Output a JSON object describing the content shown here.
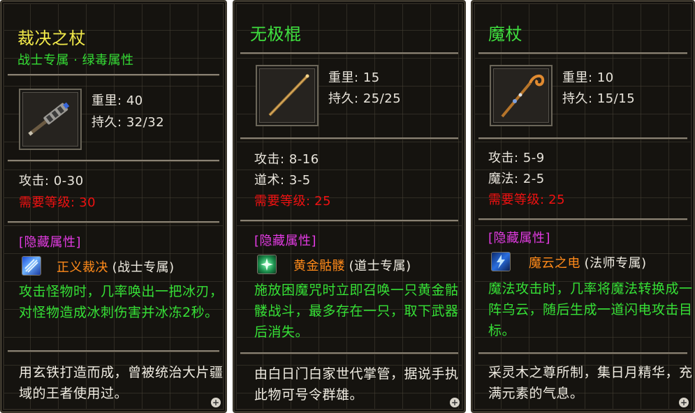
{
  "panels": [
    {
      "title": "裁决之杖",
      "subtitle": "战士专属 · 绿毒属性",
      "weight_label": "重里:",
      "weight_value": "40",
      "durability_label": "持久:",
      "durability_value": "32/32",
      "stats": [
        {
          "label": "攻击:",
          "value": "0-30"
        }
      ],
      "required_level_label": "需要等级:",
      "required_level_value": "30",
      "hidden_attr_label": "[隐藏属性]",
      "skill_name": "正义裁决",
      "skill_class": "(战士专属)",
      "skill_icon": "ice-blade-icon",
      "skill_description": "攻击怪物时，几率唤出一把冰刃，对怪物造成冰刺伤害并冰冻2秒。",
      "lore": "用玄铁打造而成，曾被统治大片疆域的王者使用过。",
      "weapon_icon": "heavy-mace-icon"
    },
    {
      "title": "无极棍",
      "subtitle": "",
      "weight_label": "重里:",
      "weight_value": "15",
      "durability_label": "持久:",
      "durability_value": "25/25",
      "stats": [
        {
          "label": "攻击:",
          "value": "8-16"
        },
        {
          "label": "道术:",
          "value": "3-5"
        }
      ],
      "required_level_label": "需要等级:",
      "required_level_value": "25",
      "hidden_attr_label": "[隐藏属性]",
      "skill_name": "黄金骷髅",
      "skill_class": "(道士专属)",
      "skill_icon": "summon-skeleton-icon",
      "skill_description": "施放困魔咒时立即召唤一只黄金骷髅战斗，最多存在一只，取下武器后消失。",
      "lore": "由白日门白家世代掌管，据说手执此物可号令群雄。",
      "weapon_icon": "staff-icon"
    },
    {
      "title": "魔杖",
      "subtitle": "",
      "weight_label": "重里:",
      "weight_value": "10",
      "durability_label": "持久:",
      "durability_value": "15/15",
      "stats": [
        {
          "label": "攻击:",
          "value": "5-9"
        },
        {
          "label": "魔法:",
          "value": "2-5"
        }
      ],
      "required_level_label": "需要等级:",
      "required_level_value": "25",
      "hidden_attr_label": "[隐藏属性]",
      "skill_name": "魔云之电",
      "skill_class": "(法师专属)",
      "skill_icon": "lightning-cloud-icon",
      "skill_description": "魔法攻击时，几率将魔法转换成一阵乌云，随后生成一道闪电攻击目标。",
      "lore": "采灵木之尊所制，集日月精华，充满元素的气息。",
      "weapon_icon": "magic-wand-icon"
    }
  ],
  "colors": {
    "title_yellow": "#f2ea4a",
    "title_green": "#3fe03f",
    "required_red": "#ee1111",
    "hidden_magenta": "#e23be2",
    "skill_orange": "#ff8a1a",
    "description_green": "#36e036"
  }
}
